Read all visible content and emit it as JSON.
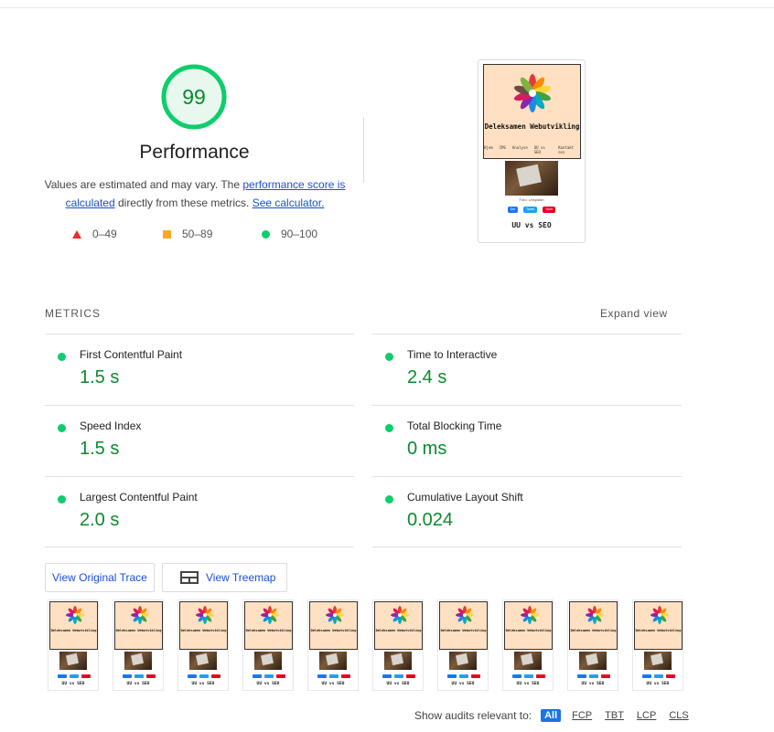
{
  "score": {
    "value": "99",
    "fraction": 0.99,
    "color": "#0cce6b"
  },
  "category_title": "Performance",
  "description": {
    "prefix": "Values are estimated and may vary. The ",
    "link1": "performance score is calculated",
    "middle": " directly from these metrics. ",
    "link2": "See calculator."
  },
  "legend": [
    {
      "range": "0–49",
      "shape": "triangle",
      "color": "#eb2b2b"
    },
    {
      "range": "50–89",
      "shape": "square",
      "color": "#f9a825"
    },
    {
      "range": "90–100",
      "shape": "circle",
      "color": "#0cce6b"
    }
  ],
  "final_screenshot": {
    "site_title": "Deleksamen Webutvikling",
    "nav": [
      "Hjem",
      "CMS",
      "Analyse",
      "UU vs SEO",
      "Kontakt oss"
    ],
    "caption": "Foto: Unsplash",
    "share": [
      "Del",
      "Tweet",
      "Save"
    ],
    "heading": "UU vs SEO"
  },
  "metrics_section": {
    "label": "METRICS",
    "expand": "Expand view",
    "items": [
      {
        "name": "First Contentful Paint",
        "value": "1.5 s",
        "status": "good"
      },
      {
        "name": "Time to Interactive",
        "value": "2.4 s",
        "status": "good"
      },
      {
        "name": "Speed Index",
        "value": "1.5 s",
        "status": "good"
      },
      {
        "name": "Total Blocking Time",
        "value": "0 ms",
        "status": "good"
      },
      {
        "name": "Largest Contentful Paint",
        "value": "2.0 s",
        "status": "good"
      },
      {
        "name": "Cumulative Layout Shift",
        "value": "0.024",
        "status": "good"
      }
    ]
  },
  "buttons": {
    "trace": "View Original Trace",
    "treemap": "View Treemap"
  },
  "filmstrip": {
    "frame_count": 10,
    "site_title": "Deleksamen Webutvikling",
    "heading": "UU vs SEO"
  },
  "filter": {
    "label": "Show audits relevant to:",
    "chips": [
      "All",
      "FCP",
      "TBT",
      "LCP",
      "CLS"
    ],
    "active": "All"
  },
  "colors": {
    "good": "#0b8a2e",
    "link": "#1a4fd9",
    "accent": "#1a73e8"
  }
}
